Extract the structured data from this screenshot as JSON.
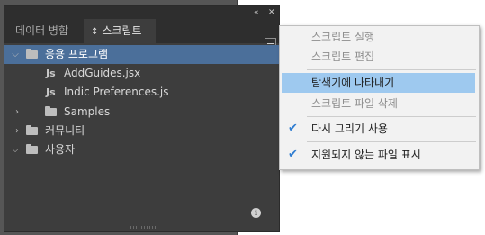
{
  "panel": {
    "collapse_glyph": "«",
    "close_glyph": "✕",
    "tabs": [
      {
        "label": "데이터 병합",
        "active": false
      },
      {
        "label": "스크립트",
        "active": true,
        "icon": "updown-arrows-icon"
      }
    ],
    "tab_arrow_glyph": "↕",
    "menu_button_icon": "panel-menu-icon",
    "info_glyph": "i"
  },
  "tree": {
    "items": [
      {
        "label": "응용 프로그램",
        "type": "folder",
        "expanded": true,
        "selected": true
      },
      {
        "label": "AddGuides.jsx",
        "type": "script"
      },
      {
        "label": "Indic Preferences.js",
        "type": "script"
      },
      {
        "label": "Samples",
        "type": "folder",
        "expanded": false
      },
      {
        "label": "커뮤니티",
        "type": "folder",
        "expanded": false
      },
      {
        "label": "사용자",
        "type": "folder",
        "expanded": true
      }
    ],
    "expanded_glyph": "⌵",
    "collapsed_glyph": "›",
    "script_glyph": "Js"
  },
  "context_menu": {
    "check_glyph": "✔",
    "items": [
      {
        "label": "스크립트 실행",
        "enabled": false
      },
      {
        "label": "스크립트 편집",
        "enabled": false
      },
      {
        "label": "탐색기에 나타내기",
        "enabled": true,
        "highlighted": true
      },
      {
        "label": "스크립트 파일 삭제",
        "enabled": false
      },
      {
        "label": "다시 그리기 사용",
        "enabled": true,
        "checked": true
      },
      {
        "label": "지원되지 않는 파일 표시",
        "enabled": true,
        "checked": true
      }
    ]
  },
  "colors": {
    "panel_bg": "#3d3d3d",
    "selection": "#4b6f9a",
    "menu_highlight": "#9ec9ef",
    "check": "#2f7dd1"
  }
}
